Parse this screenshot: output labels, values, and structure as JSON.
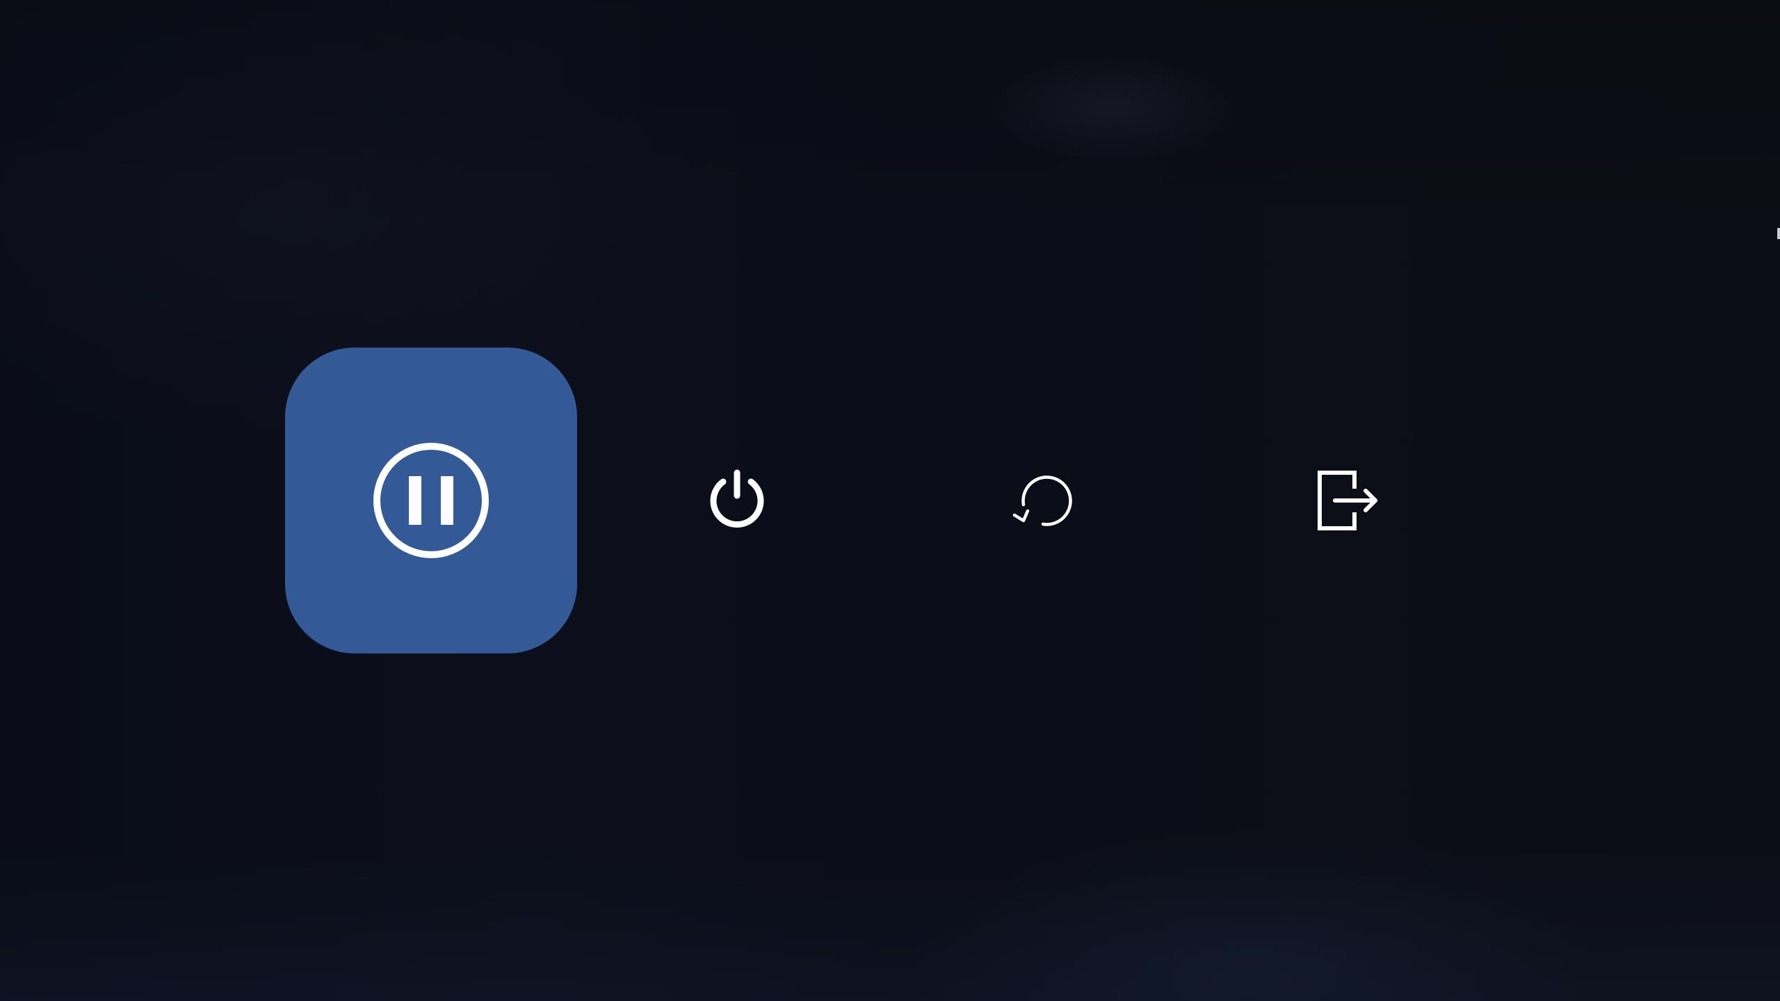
{
  "power_menu": {
    "accent_color": "#335a97",
    "icon_color": "#ffffff",
    "selected_index": 0,
    "options": [
      {
        "id": "suspend",
        "icon": "pause-circle-icon",
        "selected": true
      },
      {
        "id": "shutdown",
        "icon": "power-icon",
        "selected": false
      },
      {
        "id": "restart",
        "icon": "restart-icon",
        "selected": false
      },
      {
        "id": "logout",
        "icon": "logout-icon",
        "selected": false
      }
    ]
  }
}
